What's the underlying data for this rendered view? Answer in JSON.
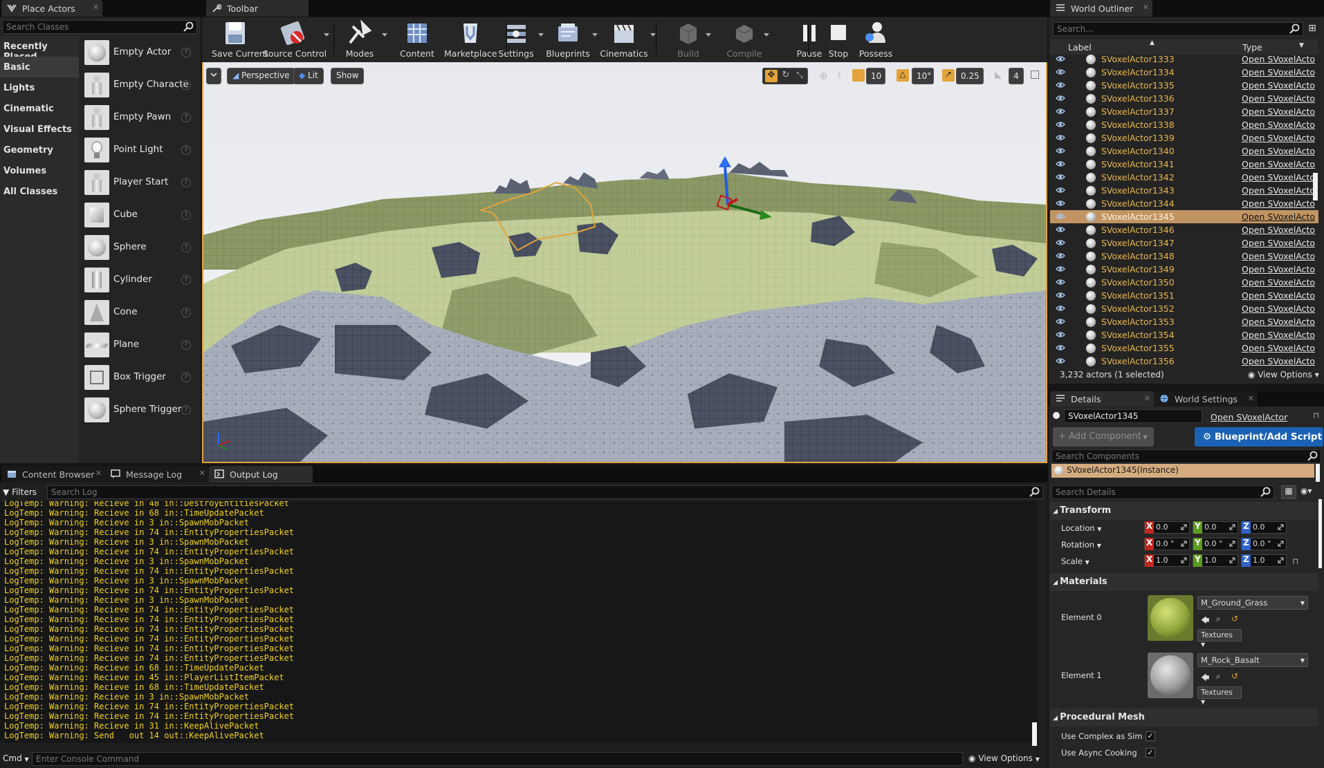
{
  "tabs": {
    "place_actors": "Place Actors",
    "toolbar": "Toolbar",
    "world_outliner": "World Outliner",
    "content_browser": "Content Browser",
    "message_log": "Message Log",
    "output_log": "Output Log",
    "details": "Details",
    "world_settings": "World Settings"
  },
  "place_actors": {
    "search_placeholder": "Search Classes",
    "categories": [
      "Recently Placed",
      "Basic",
      "Lights",
      "Cinematic",
      "Visual Effects",
      "Geometry",
      "Volumes",
      "All Classes"
    ],
    "selected_category": "Basic",
    "items": [
      "Empty Actor",
      "Empty Character",
      "Empty Pawn",
      "Point Light",
      "Player Start",
      "Cube",
      "Sphere",
      "Cylinder",
      "Cone",
      "Plane",
      "Box Trigger",
      "Sphere Trigger"
    ]
  },
  "toolbar": {
    "buttons": [
      {
        "label": "Save Current",
        "icon": "save-icon"
      },
      {
        "label": "Source Control",
        "icon": "source-control-icon"
      },
      {
        "label": "Modes",
        "icon": "modes-icon"
      },
      {
        "label": "Content",
        "icon": "content-icon"
      },
      {
        "label": "Marketplace",
        "icon": "marketplace-icon"
      },
      {
        "label": "Settings",
        "icon": "settings-icon"
      },
      {
        "label": "Blueprints",
        "icon": "blueprints-icon"
      },
      {
        "label": "Cinematics",
        "icon": "cinematics-icon"
      },
      {
        "label": "Build",
        "icon": "build-icon"
      },
      {
        "label": "Compile",
        "icon": "compile-icon"
      },
      {
        "label": "Pause",
        "icon": "pause-icon"
      },
      {
        "label": "Stop",
        "icon": "stop-icon"
      },
      {
        "label": "Possess",
        "icon": "possess-icon"
      }
    ]
  },
  "viewport": {
    "perspective": "Perspective",
    "lit": "Lit",
    "show": "Show",
    "grid_snap": "10",
    "rotation_snap": "10°",
    "scale_snap": "0.25",
    "camera_speed": "4"
  },
  "outliner": {
    "search_placeholder": "Search...",
    "col_label": "Label",
    "col_type": "Type",
    "rows": [
      "SVoxelActor1333",
      "SVoxelActor1334",
      "SVoxelActor1335",
      "SVoxelActor1336",
      "SVoxelActor1337",
      "SVoxelActor1338",
      "SVoxelActor1339",
      "SVoxelActor1340",
      "SVoxelActor1341",
      "SVoxelActor1342",
      "SVoxelActor1343",
      "SVoxelActor1344",
      "SVoxelActor1345",
      "SVoxelActor1346",
      "SVoxelActor1347",
      "SVoxelActor1348",
      "SVoxelActor1349",
      "SVoxelActor1350",
      "SVoxelActor1351",
      "SVoxelActor1352",
      "SVoxelActor1353",
      "SVoxelActor1354",
      "SVoxelActor1355",
      "SVoxelActor1356"
    ],
    "row_type": "Open SVoxelActo",
    "selected_row": "SVoxelActor1345",
    "status": "3,232 actors (1 selected)",
    "view_options": "View Options"
  },
  "log": {
    "filters": "Filters",
    "search_placeholder": "Search Log",
    "lines": [
      "LogTemp: Warning: Recieve in 48 in::DestroyEntitiesPacket",
      "LogTemp: Warning: Recieve in 68 in::TimeUpdatePacket",
      "LogTemp: Warning: Recieve in 3 in::SpawnMobPacket",
      "LogTemp: Warning: Recieve in 74 in::EntityPropertiesPacket",
      "LogTemp: Warning: Recieve in 3 in::SpawnMobPacket",
      "LogTemp: Warning: Recieve in 74 in::EntityPropertiesPacket",
      "LogTemp: Warning: Recieve in 3 in::SpawnMobPacket",
      "LogTemp: Warning: Recieve in 74 in::EntityPropertiesPacket",
      "LogTemp: Warning: Recieve in 3 in::SpawnMobPacket",
      "LogTemp: Warning: Recieve in 74 in::EntityPropertiesPacket",
      "LogTemp: Warning: Recieve in 3 in::SpawnMobPacket",
      "LogTemp: Warning: Recieve in 74 in::EntityPropertiesPacket",
      "LogTemp: Warning: Recieve in 74 in::EntityPropertiesPacket",
      "LogTemp: Warning: Recieve in 74 in::EntityPropertiesPacket",
      "LogTemp: Warning: Recieve in 74 in::EntityPropertiesPacket",
      "LogTemp: Warning: Recieve in 74 in::EntityPropertiesPacket",
      "LogTemp: Warning: Recieve in 74 in::EntityPropertiesPacket",
      "LogTemp: Warning: Recieve in 68 in::TimeUpdatePacket",
      "LogTemp: Warning: Recieve in 45 in::PlayerListItemPacket",
      "LogTemp: Warning: Recieve in 68 in::TimeUpdatePacket",
      "LogTemp: Warning: Recieve in 3 in::SpawnMobPacket",
      "LogTemp: Warning: Recieve in 74 in::EntityPropertiesPacket",
      "LogTemp: Warning: Recieve in 74 in::EntityPropertiesPacket",
      "LogTemp: Warning: Recieve in 31 in::KeepAlivePacket",
      "LogTemp: Warning: Send   out 14 out::KeepAlivePacket"
    ],
    "cmd": "Cmd",
    "console_placeholder": "Enter Console Command",
    "view_options": "View Options"
  },
  "details": {
    "actor_name": "SVoxelActor1345",
    "open_link": "Open SVoxelActor",
    "add_component": "+ Add Component",
    "blueprint_script": "Blueprint/Add Script",
    "search_components": "Search Components",
    "instance": "SVoxelActor1345(Instance)",
    "search_details": "Search Details",
    "transform": "Transform",
    "location": "Location",
    "rotation": "Rotation",
    "scale": "Scale",
    "loc": [
      "0.0",
      "0.0",
      "0.0"
    ],
    "rot": [
      "0.0 °",
      "0.0 °",
      "0.0 °"
    ],
    "scl": [
      "1.0",
      "1.0",
      "1.0"
    ],
    "materials": "Materials",
    "element0": "Element 0",
    "element1": "Element 1",
    "mat0": "M_Ground_Grass",
    "mat1": "M_Rock_Basalt",
    "textures": "Textures",
    "procedural_mesh": "Procedural Mesh",
    "use_complex": "Use Complex as Simple",
    "use_async": "Use Async Cooking",
    "use_complex_checked": true,
    "use_async_checked": true
  },
  "colors": {
    "accent": "#e3a33b",
    "selection": "#c19563",
    "log_warning": "#f2d21b",
    "blueprint_button": "#1b62b4"
  }
}
